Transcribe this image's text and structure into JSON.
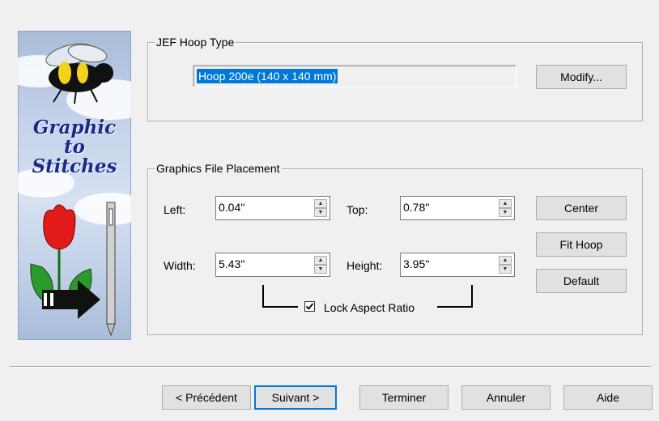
{
  "banner": {
    "line1": "Graphic",
    "line2": "to",
    "line3": "Stitches"
  },
  "hoop": {
    "group_title": "JEF Hoop Type",
    "selected": "Hoop 200e (140 x 140 mm)",
    "modify_label": "Modify..."
  },
  "placement": {
    "group_title": "Graphics File Placement",
    "left_label": "Left:",
    "left_value": "0.04''",
    "top_label": "Top:",
    "top_value": "0.78''",
    "width_label": "Width:",
    "width_value": "5.43''",
    "height_label": "Height:",
    "height_value": "3.95''",
    "center_label": "Center",
    "fit_hoop_label": "Fit Hoop",
    "default_label": "Default",
    "lock_label": "Lock Aspect Ratio",
    "lock_checked": true
  },
  "footer": {
    "prev_label": "< Précédent",
    "next_label": "Suivant >",
    "finish_label": "Terminer",
    "cancel_label": "Annuler",
    "help_label": "Aide"
  },
  "colors": {
    "selection": "#0078d7",
    "banner_text": "#1c2a8a",
    "dialog_bg": "#f0f0f0"
  }
}
